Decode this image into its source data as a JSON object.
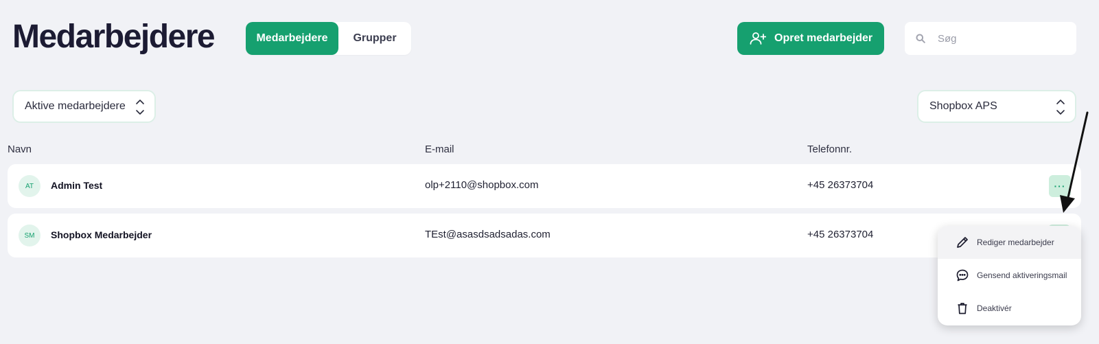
{
  "header": {
    "title": "Medarbejdere",
    "tabs": [
      {
        "label": "Medarbejdere",
        "active": true
      },
      {
        "label": "Grupper",
        "active": false
      }
    ],
    "create_button": "Opret medarbejder",
    "search_placeholder": "Søg"
  },
  "filters": {
    "status": "Aktive medarbejdere",
    "company": "Shopbox APS"
  },
  "table": {
    "columns": [
      "Navn",
      "E-mail",
      "Telefonnr."
    ],
    "rows": [
      {
        "initials": "AT",
        "name": "Admin Test",
        "email": "olp+2110@shopbox.com",
        "phone": "+45 26373704",
        "actions": "···"
      },
      {
        "initials": "SM",
        "name": "Shopbox Medarbejder",
        "email": "TEst@asasdsadsadas.com",
        "phone": "+45 26373704"
      }
    ]
  },
  "menu": {
    "items": [
      {
        "label": "Rediger medarbejder",
        "icon": "pencil-icon"
      },
      {
        "label": "Gensend aktiveringsmail",
        "icon": "chat-bubble-icon"
      },
      {
        "label": "Deaktivér",
        "icon": "trash-icon"
      }
    ]
  },
  "colors": {
    "accent": "#16a06f",
    "background": "#f1f2f6",
    "avatar_bg": "#e2f4ec"
  }
}
